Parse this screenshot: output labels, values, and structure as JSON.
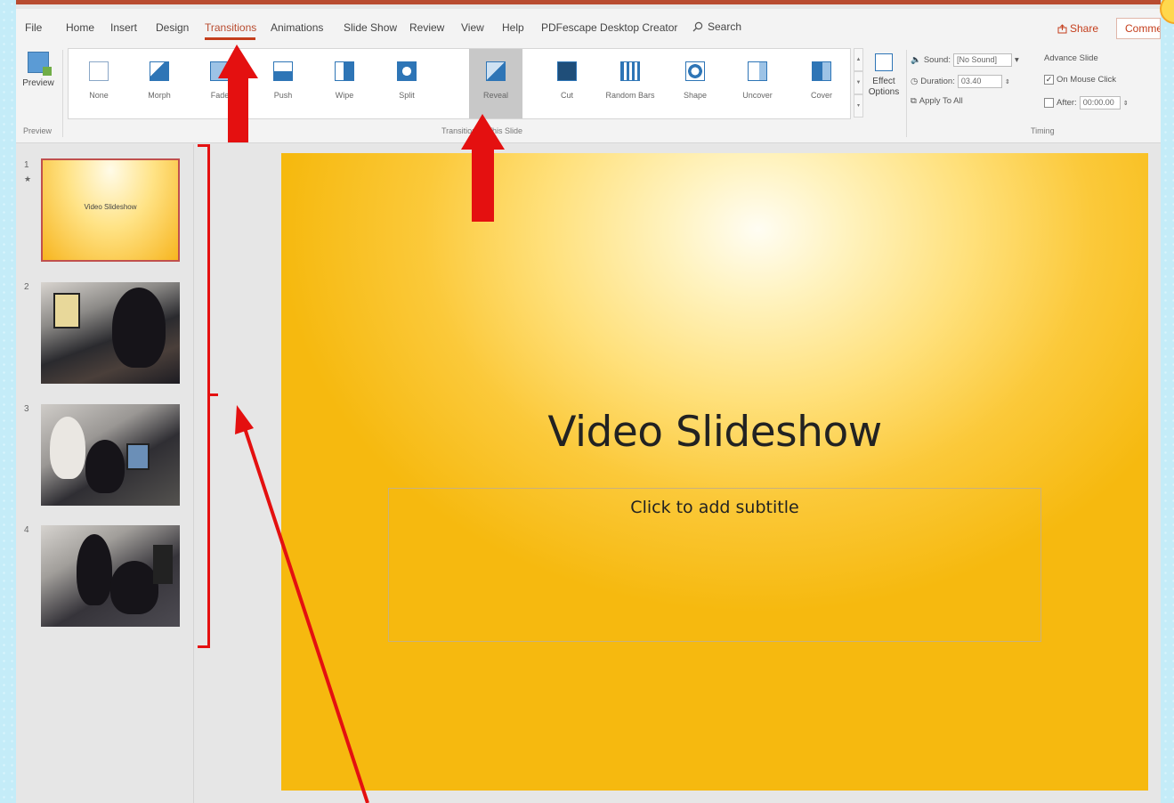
{
  "tabs": [
    "File",
    "Home",
    "Insert",
    "Design",
    "Transitions",
    "Animations",
    "Slide Show",
    "Review",
    "View",
    "Help",
    "PDFescape Desktop Creator"
  ],
  "active_tab": "Transitions",
  "search": {
    "label": "Search",
    "icon": "search-icon"
  },
  "share_label": "Share",
  "comments_label": "Comments",
  "ribbon": {
    "preview": {
      "button_label": "Preview",
      "group_label": "Preview"
    },
    "transitions_group_label": "Transition to This Slide",
    "transitions": [
      {
        "label": "None"
      },
      {
        "label": "Morph"
      },
      {
        "label": "Fade"
      },
      {
        "label": "Push"
      },
      {
        "label": "Wipe"
      },
      {
        "label": "Split"
      },
      {
        "label": "Reveal",
        "selected": true
      },
      {
        "label": "Cut"
      },
      {
        "label": "Random Bars"
      },
      {
        "label": "Shape"
      },
      {
        "label": "Uncover"
      },
      {
        "label": "Cover"
      }
    ],
    "effect_options": {
      "line1": "Effect",
      "line2": "Options"
    },
    "timing": {
      "sound_label": "Sound:",
      "sound_value": "[No Sound]",
      "duration_label": "Duration:",
      "duration_value": "03.40",
      "apply_all_label": "Apply To All",
      "advance_slide_label": "Advance Slide",
      "on_mouse_click_label": "On Mouse Click",
      "on_mouse_click_checked": true,
      "after_label": "After:",
      "after_value": "00:00.00",
      "group_label": "Timing"
    }
  },
  "thumbnails": [
    {
      "number": "1",
      "star": "★",
      "title": "Video Slideshow"
    },
    {
      "number": "2"
    },
    {
      "number": "3"
    },
    {
      "number": "4"
    }
  ],
  "slide": {
    "title": "Video Slideshow",
    "subtitle_placeholder": "Click to add subtitle"
  },
  "colors": {
    "accent": "#c43e1c",
    "annotation": "#e41010",
    "slide_gold": "#f6b90f"
  }
}
